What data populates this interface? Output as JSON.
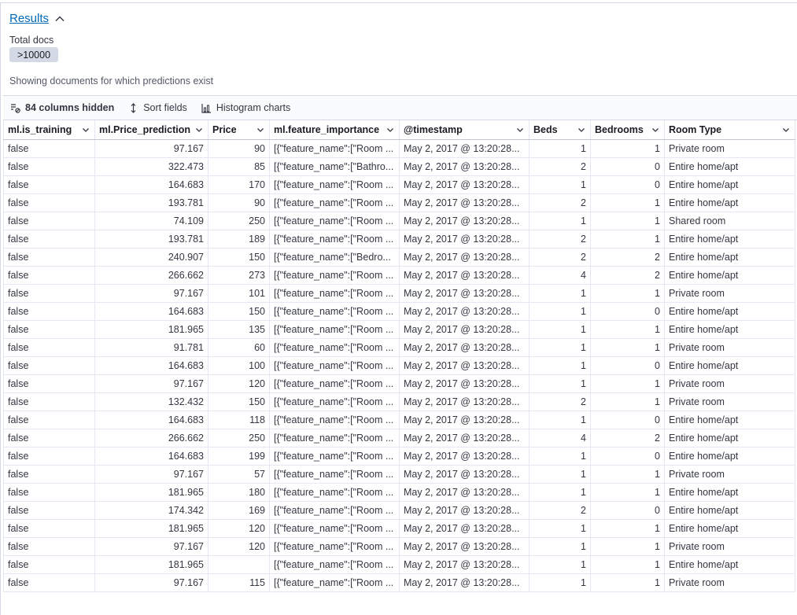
{
  "results": {
    "title": "Results",
    "total_label": "Total docs",
    "total_value": ">10000",
    "info": "Showing documents for which predictions exist"
  },
  "toolbar": {
    "columns_hidden": "84 columns hidden",
    "sort_fields": "Sort fields",
    "histogram": "Histogram charts"
  },
  "columns": [
    "ml.is_training",
    "ml.Price_prediction",
    "Price",
    "ml.feature_importance",
    "@timestamp",
    "Beds",
    "Bedrooms",
    "Room Type"
  ],
  "rows": [
    [
      "false",
      "97.167",
      "90",
      "[{\"feature_name\":[\"Room ...",
      "May 2, 2017 @ 13:20:28...",
      "1",
      "1",
      "Private room"
    ],
    [
      "false",
      "322.473",
      "85",
      "[{\"feature_name\":[\"Bathro...",
      "May 2, 2017 @ 13:20:28...",
      "2",
      "0",
      "Entire home/apt"
    ],
    [
      "false",
      "164.683",
      "170",
      "[{\"feature_name\":[\"Room ...",
      "May 2, 2017 @ 13:20:28...",
      "1",
      "0",
      "Entire home/apt"
    ],
    [
      "false",
      "193.781",
      "90",
      "[{\"feature_name\":[\"Room ...",
      "May 2, 2017 @ 13:20:28...",
      "2",
      "1",
      "Entire home/apt"
    ],
    [
      "false",
      "74.109",
      "250",
      "[{\"feature_name\":[\"Room ...",
      "May 2, 2017 @ 13:20:28...",
      "1",
      "1",
      "Shared room"
    ],
    [
      "false",
      "193.781",
      "189",
      "[{\"feature_name\":[\"Room ...",
      "May 2, 2017 @ 13:20:28...",
      "2",
      "1",
      "Entire home/apt"
    ],
    [
      "false",
      "240.907",
      "150",
      "[{\"feature_name\":[\"Bedro...",
      "May 2, 2017 @ 13:20:28...",
      "2",
      "2",
      "Entire home/apt"
    ],
    [
      "false",
      "266.662",
      "273",
      "[{\"feature_name\":[\"Room ...",
      "May 2, 2017 @ 13:20:28...",
      "4",
      "2",
      "Entire home/apt"
    ],
    [
      "false",
      "97.167",
      "101",
      "[{\"feature_name\":[\"Room ...",
      "May 2, 2017 @ 13:20:28...",
      "1",
      "1",
      "Private room"
    ],
    [
      "false",
      "164.683",
      "150",
      "[{\"feature_name\":[\"Room ...",
      "May 2, 2017 @ 13:20:28...",
      "1",
      "0",
      "Entire home/apt"
    ],
    [
      "false",
      "181.965",
      "135",
      "[{\"feature_name\":[\"Room ...",
      "May 2, 2017 @ 13:20:28...",
      "1",
      "1",
      "Entire home/apt"
    ],
    [
      "false",
      "91.781",
      "60",
      "[{\"feature_name\":[\"Room ...",
      "May 2, 2017 @ 13:20:28...",
      "1",
      "1",
      "Private room"
    ],
    [
      "false",
      "164.683",
      "100",
      "[{\"feature_name\":[\"Room ...",
      "May 2, 2017 @ 13:20:28...",
      "1",
      "0",
      "Entire home/apt"
    ],
    [
      "false",
      "97.167",
      "120",
      "[{\"feature_name\":[\"Room ...",
      "May 2, 2017 @ 13:20:28...",
      "1",
      "1",
      "Private room"
    ],
    [
      "false",
      "132.432",
      "150",
      "[{\"feature_name\":[\"Room ...",
      "May 2, 2017 @ 13:20:28...",
      "2",
      "1",
      "Private room"
    ],
    [
      "false",
      "164.683",
      "118",
      "[{\"feature_name\":[\"Room ...",
      "May 2, 2017 @ 13:20:28...",
      "1",
      "0",
      "Entire home/apt"
    ],
    [
      "false",
      "266.662",
      "250",
      "[{\"feature_name\":[\"Room ...",
      "May 2, 2017 @ 13:20:28...",
      "4",
      "2",
      "Entire home/apt"
    ],
    [
      "false",
      "164.683",
      "199",
      "[{\"feature_name\":[\"Room ...",
      "May 2, 2017 @ 13:20:28...",
      "1",
      "0",
      "Entire home/apt"
    ],
    [
      "false",
      "97.167",
      "57",
      "[{\"feature_name\":[\"Room ...",
      "May 2, 2017 @ 13:20:28...",
      "1",
      "1",
      "Private room"
    ],
    [
      "false",
      "181.965",
      "180",
      "[{\"feature_name\":[\"Room ...",
      "May 2, 2017 @ 13:20:28...",
      "1",
      "1",
      "Entire home/apt"
    ],
    [
      "false",
      "174.342",
      "169",
      "[{\"feature_name\":[\"Room ...",
      "May 2, 2017 @ 13:20:28...",
      "2",
      "0",
      "Entire home/apt"
    ],
    [
      "false",
      "181.965",
      "120",
      "[{\"feature_name\":[\"Room ...",
      "May 2, 2017 @ 13:20:28...",
      "1",
      "1",
      "Entire home/apt"
    ],
    [
      "false",
      "97.167",
      "120",
      "[{\"feature_name\":[\"Room ...",
      "May 2, 2017 @ 13:20:28...",
      "1",
      "1",
      "Private room"
    ],
    [
      "false",
      "181.965",
      "",
      "[{\"feature_name\":[\"Room ...",
      "May 2, 2017 @ 13:20:28...",
      "1",
      "1",
      "Entire home/apt"
    ],
    [
      "false",
      "97.167",
      "115",
      "[{\"feature_name\":[\"Room ...",
      "May 2, 2017 @ 13:20:28...",
      "1",
      "1",
      "Private room"
    ]
  ]
}
